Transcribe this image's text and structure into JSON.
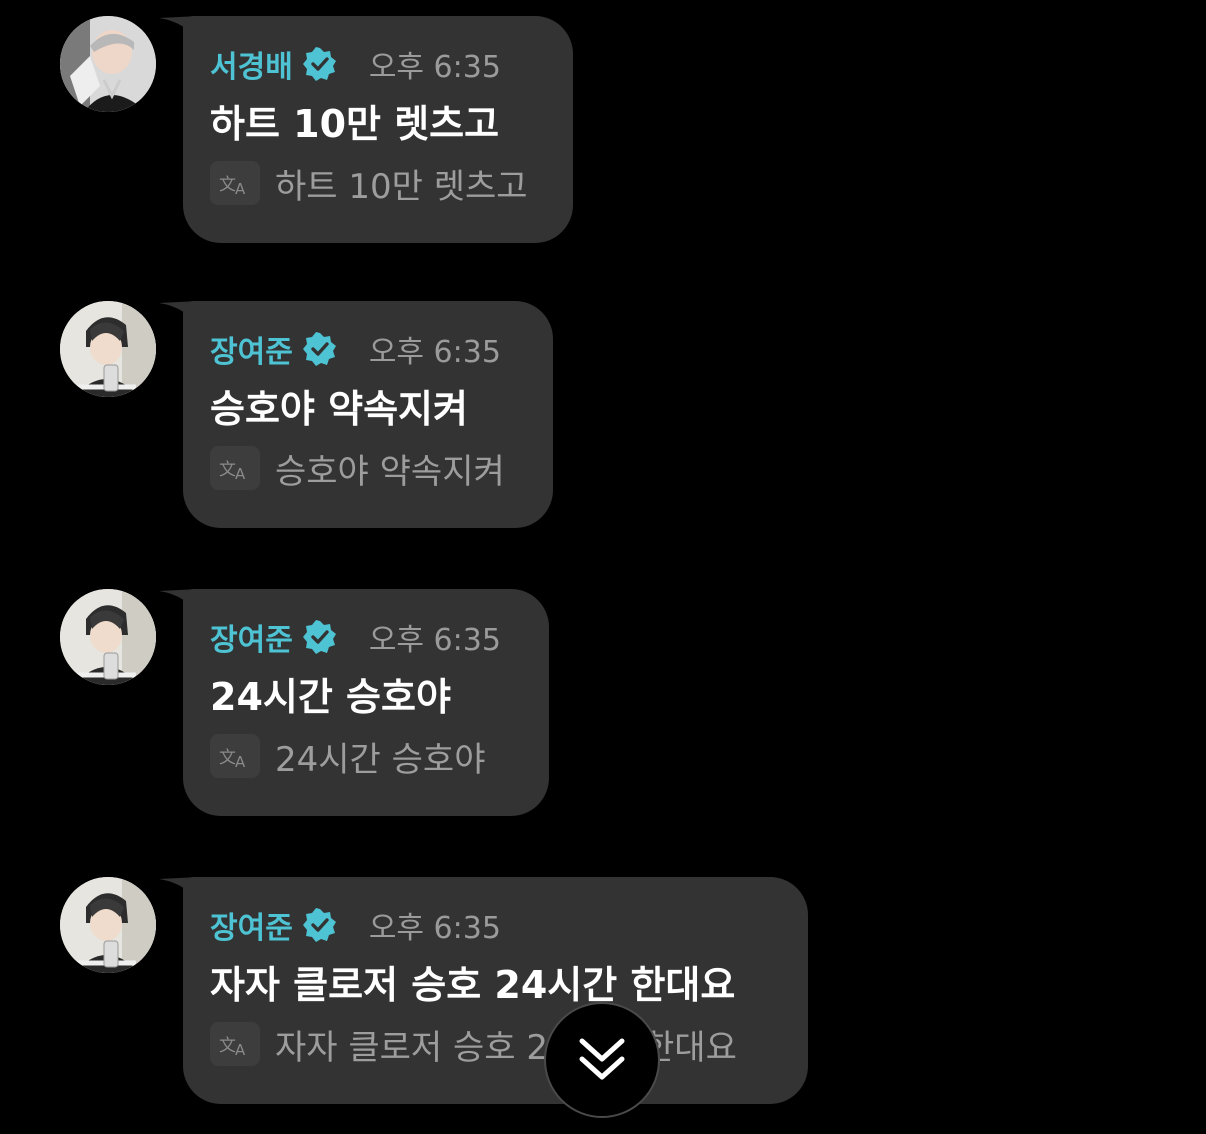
{
  "messages": [
    {
      "sender": "서경배",
      "verified": true,
      "time": "오후 6:35",
      "text": "하트 10만 렛츠고",
      "translation": "하트 10만 렛츠고",
      "avatar": "avatar-seo"
    },
    {
      "sender": "장여준",
      "verified": true,
      "time": "오후 6:35",
      "text": "승호야 약속지켜",
      "translation": "승호야 약속지켜",
      "avatar": "avatar-jang"
    },
    {
      "sender": "장여준",
      "verified": true,
      "time": "오후 6:35",
      "text": "24시간 승호야",
      "translation": "24시간 승호야",
      "avatar": "avatar-jang"
    },
    {
      "sender": "장여준",
      "verified": true,
      "time": "오후 6:35",
      "text": "자자 클로저 승호 24시간 한대요",
      "translation": "자자 클로저 승호 24시간 한대요",
      "avatar": "avatar-jang"
    }
  ],
  "icons": {
    "verified": "verified-badge-icon",
    "translate": "translate-icon",
    "scroll": "double-chevron-down-icon"
  },
  "colors": {
    "background": "#000000",
    "bubble": "#333333",
    "sender_name": "#4ec3d3",
    "verified_badge": "#4ec3d3",
    "time": "#9b9b9b",
    "message_text": "#ffffff",
    "translation_text": "#9d9d9d"
  }
}
